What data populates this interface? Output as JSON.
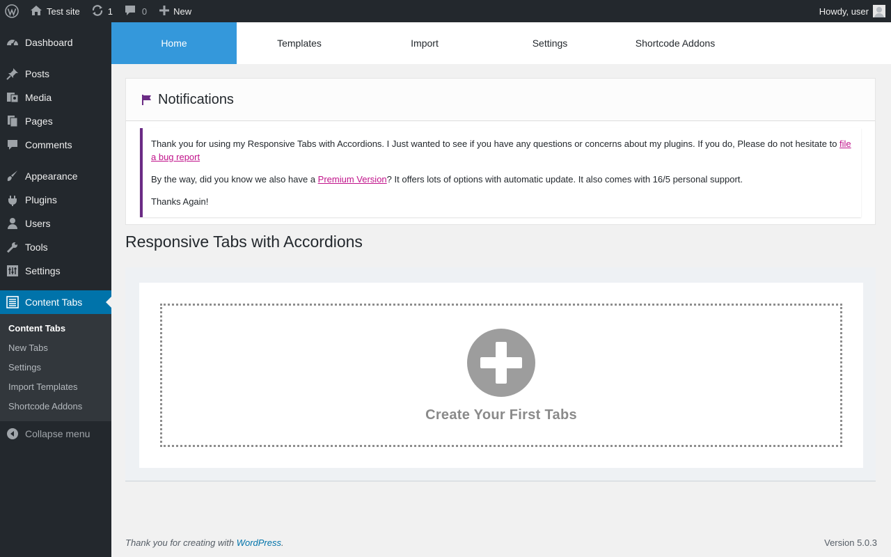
{
  "admin_bar": {
    "site_name": "Test site",
    "updates_count": "1",
    "comments_count": "0",
    "new_label": "New",
    "greeting": "Howdy, user"
  },
  "sidebar": {
    "items": [
      {
        "label": "Dashboard",
        "icon": "dashboard-icon"
      },
      {
        "label": "Posts",
        "icon": "pin-icon"
      },
      {
        "label": "Media",
        "icon": "media-icon"
      },
      {
        "label": "Pages",
        "icon": "pages-icon"
      },
      {
        "label": "Comments",
        "icon": "comment-icon"
      },
      {
        "label": "Appearance",
        "icon": "brush-icon"
      },
      {
        "label": "Plugins",
        "icon": "plug-icon"
      },
      {
        "label": "Users",
        "icon": "user-icon"
      },
      {
        "label": "Tools",
        "icon": "wrench-icon"
      },
      {
        "label": "Settings",
        "icon": "settings-icon"
      },
      {
        "label": "Content Tabs",
        "icon": "list-icon"
      }
    ],
    "submenu": [
      "Content Tabs",
      "New Tabs",
      "Settings",
      "Import Templates",
      "Shortcode Addons"
    ],
    "collapse_label": "Collapse menu"
  },
  "tabs": [
    "Home",
    "Templates",
    "Import",
    "Settings",
    "Shortcode Addons"
  ],
  "notifications": {
    "title": "Notifications",
    "p1_text": "Thank you for using my Responsive Tabs with Accordions. I Just wanted to see if you have any questions or concerns about my plugins. If you do, Please do not hesitate to ",
    "p1_link": "file a bug report",
    "p2_pre": "By the way, did you know we also have a ",
    "p2_link": "Premium Version",
    "p2_post": "? It offers lots of options with automatic update. It also comes with 16/5 personal support.",
    "p3_text": "Thanks Again!"
  },
  "main": {
    "section_title": "Responsive Tabs with Accordions",
    "create_label": "Create Your First Tabs"
  },
  "footer": {
    "thanks_pre": "Thank you for creating with ",
    "thanks_link": "WordPress",
    "thanks_post": ".",
    "version": "Version 5.0.3"
  },
  "colors": {
    "active_tab": "#3498db",
    "sidebar_active": "#0073aa",
    "notice_border": "#6b2c85",
    "notice_link": "#c0128a"
  }
}
